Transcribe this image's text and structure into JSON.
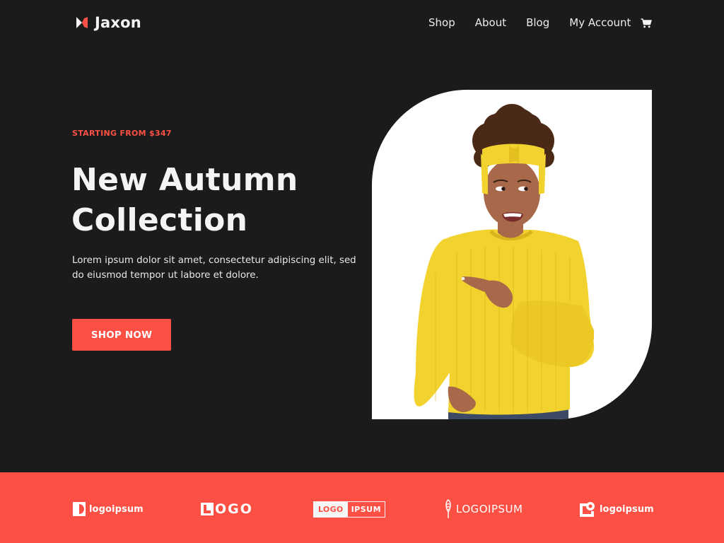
{
  "header": {
    "brand_name": "Jaxon",
    "brand_icon": "bowtie-logo-icon",
    "nav": [
      {
        "label": "Shop"
      },
      {
        "label": "About"
      },
      {
        "label": "Blog"
      },
      {
        "label": "My Account"
      }
    ],
    "cart_icon": "shopping-cart-icon"
  },
  "hero": {
    "eyebrow": "STARTING FROM $347",
    "title_line1": "New Autumn",
    "title_line2": "Collection",
    "description": "Lorem ipsum dolor sit amet, consectetur adipiscing elit, sed do eiusmod tempor ut labore et dolore.",
    "cta_label": "SHOP NOW",
    "image_alt": "Smiling woman in yellow knit sweater and headband pointing to the side"
  },
  "logos": [
    {
      "name": "logoipsum",
      "text": "logoipsum",
      "icon": "half-circle-square-icon"
    },
    {
      "name": "logo-letters",
      "letters": [
        "L",
        "O",
        "G",
        "O"
      ],
      "icon": "square-l-icon"
    },
    {
      "name": "logo-ipsum-boxed",
      "left": "LOGO",
      "right": "IPSUM"
    },
    {
      "name": "wheat-logoipsum",
      "text": "LOGOIPSUM",
      "icon": "wheat-icon"
    },
    {
      "name": "pin-logoipsum",
      "text": "logoipsum",
      "icon": "square-pin-icon"
    }
  ],
  "colors": {
    "background": "#1b1b1b",
    "accent": "#fd5044",
    "text": "#f4f4f4",
    "sweater": "#f2d22e"
  }
}
